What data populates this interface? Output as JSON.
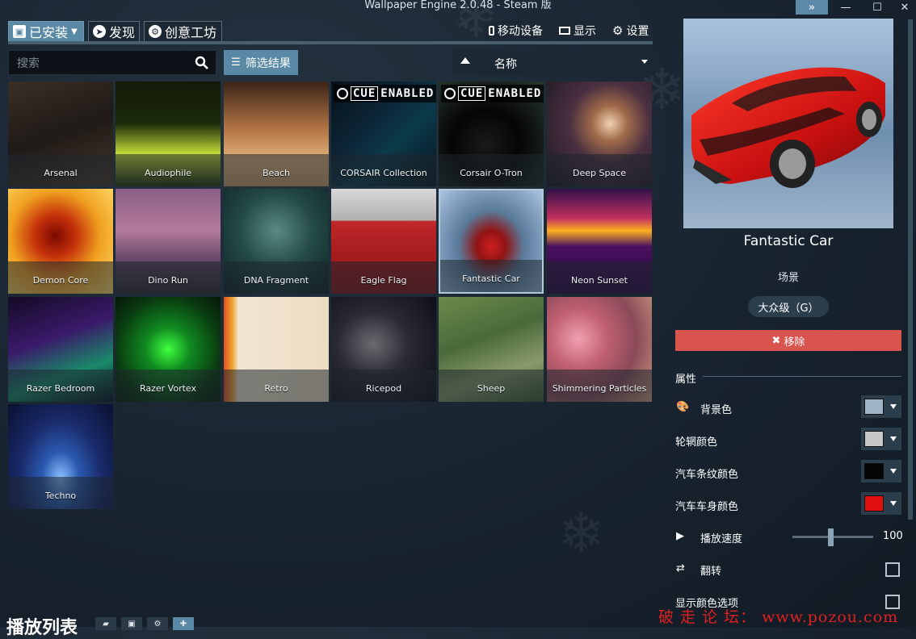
{
  "window": {
    "title": "Wallpaper Engine 2.0.48 - Steam 版"
  },
  "tabs": [
    {
      "label": "已安装",
      "icon": "save-icon"
    },
    {
      "label": "发现",
      "icon": "compass-icon"
    },
    {
      "label": "创意工坊",
      "icon": "steam-icon"
    }
  ],
  "toolbar": {
    "mobile": "移动设备",
    "display": "显示",
    "settings": "设置"
  },
  "search": {
    "placeholder": "搜索"
  },
  "filter": {
    "label": "筛选结果"
  },
  "sort": {
    "label": "名称"
  },
  "wallpapers": [
    {
      "title": "Arsenal",
      "selected": false,
      "cue": false
    },
    {
      "title": "Audiophile",
      "selected": false,
      "cue": false
    },
    {
      "title": "Beach",
      "selected": false,
      "cue": false
    },
    {
      "title": "CORSAIR Collection",
      "selected": false,
      "cue": true,
      "cue_text": "CUE",
      "cue_suffix": "ENABLED"
    },
    {
      "title": "Corsair O-Tron",
      "selected": false,
      "cue": true,
      "cue_text": "CUE",
      "cue_suffix": "ENABLED"
    },
    {
      "title": "Deep Space",
      "selected": false,
      "cue": false
    },
    {
      "title": "Demon Core",
      "selected": false,
      "cue": false
    },
    {
      "title": "Dino Run",
      "selected": false,
      "cue": false
    },
    {
      "title": "DNA Fragment",
      "selected": false,
      "cue": false
    },
    {
      "title": "Eagle Flag",
      "selected": false,
      "cue": false
    },
    {
      "title": "Fantastic Car",
      "selected": true,
      "cue": false
    },
    {
      "title": "Neon Sunset",
      "selected": false,
      "cue": false
    },
    {
      "title": "Razer Bedroom",
      "selected": false,
      "cue": false
    },
    {
      "title": "Razer Vortex",
      "selected": false,
      "cue": false
    },
    {
      "title": "Retro",
      "selected": false,
      "cue": false
    },
    {
      "title": "Ricepod",
      "selected": false,
      "cue": false
    },
    {
      "title": "Sheep",
      "selected": false,
      "cue": false
    },
    {
      "title": "Shimmering Particles",
      "selected": false,
      "cue": false
    },
    {
      "title": "Techno",
      "selected": false,
      "cue": false
    }
  ],
  "playlist": {
    "label": "播放列表"
  },
  "details": {
    "title": "Fantastic Car",
    "type": "场景",
    "rating": "大众级（G）",
    "remove": "移除",
    "section": "属性",
    "properties": {
      "bg_color": {
        "label": "背景色",
        "color": "#9fb4c6"
      },
      "rim_color": {
        "label": "轮辋颜色",
        "color": "#c8c8c8"
      },
      "stripe_color": {
        "label": "汽车条纹颜色",
        "color": "#050505"
      },
      "body_color": {
        "label": "汽车车身颜色",
        "color": "#e01010"
      },
      "speed": {
        "label": "播放速度",
        "value": "100",
        "level": 0.47
      },
      "flip": {
        "label": "翻转",
        "checked": false
      },
      "show_colors": {
        "label": "显示颜色选项",
        "checked": false
      }
    }
  },
  "watermark": "破 走 论 坛： www.pozou.com",
  "colors": {
    "accent": "#5a89a6",
    "danger": "#d9534f"
  }
}
